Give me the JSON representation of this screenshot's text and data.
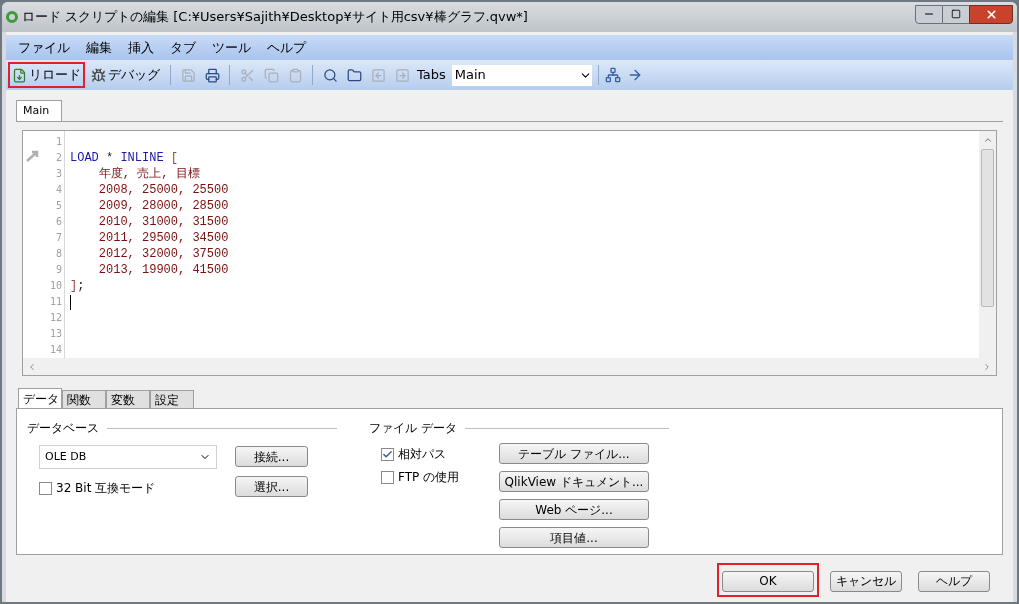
{
  "window": {
    "title": "ロード スクリプトの編集 [C:¥Users¥Sajith¥Desktop¥サイト用csv¥棒グラフ.qvw*]"
  },
  "menu": [
    "ファイル",
    "編集",
    "挿入",
    "タブ",
    "ツール",
    "ヘルプ"
  ],
  "toolbar": {
    "reload": {
      "label": "リロード",
      "highlighted": true
    },
    "debug": {
      "label": "デバッグ",
      "highlighted": false
    },
    "icon_buttons": [
      {
        "disabled": true
      },
      {
        "disabled": false
      },
      {
        "disabled": true
      },
      {
        "disabled": true
      },
      {
        "disabled": true
      },
      {
        "disabled": false
      },
      {
        "disabled": false
      },
      {
        "disabled": true
      },
      {
        "disabled": true
      }
    ],
    "tabs_label": "Tabs",
    "tab_select": "Main"
  },
  "script_tabs": [
    {
      "label": "Main",
      "selected": true
    }
  ],
  "editor": {
    "lines": [
      {
        "number": "1",
        "cursor": false
      },
      {
        "number": "2",
        "cursor": false,
        "tokens": [
          {
            "kind": "keyword",
            "text": "LOAD"
          },
          {
            "kind": "plain",
            "text": " * "
          },
          {
            "kind": "keyword",
            "text": "INLINE"
          },
          {
            "kind": "bracket",
            "text": " ["
          }
        ]
      },
      {
        "number": "3",
        "cursor": false,
        "tokens": [
          {
            "kind": "data",
            "text": "    年度, 売上, 目標"
          }
        ]
      },
      {
        "number": "4",
        "cursor": false,
        "tokens": [
          {
            "kind": "data",
            "text": "    2008, 25000, 25500"
          }
        ]
      },
      {
        "number": "5",
        "cursor": false,
        "tokens": [
          {
            "kind": "data",
            "text": "    2009, 28000, 28500"
          }
        ]
      },
      {
        "number": "6",
        "cursor": false,
        "tokens": [
          {
            "kind": "data",
            "text": "    2010, 31000, 31500"
          }
        ]
      },
      {
        "number": "7",
        "cursor": false,
        "tokens": [
          {
            "kind": "data",
            "text": "    2011, 29500, 34500"
          }
        ]
      },
      {
        "number": "8",
        "cursor": false,
        "tokens": [
          {
            "kind": "data",
            "text": "    2012, 32000, 37500"
          }
        ]
      },
      {
        "number": "9",
        "cursor": false,
        "tokens": [
          {
            "kind": "data",
            "text": "    2013, 19900, 41500"
          }
        ]
      },
      {
        "number": "10",
        "cursor": false,
        "tokens": [
          {
            "kind": "bracket",
            "text": "]"
          },
          {
            "kind": "plain",
            "text": ";"
          }
        ]
      },
      {
        "number": "11",
        "cursor": true
      },
      {
        "number": "12",
        "cursor": false
      },
      {
        "number": "13",
        "cursor": false
      },
      {
        "number": "14",
        "cursor": false
      }
    ]
  },
  "panel_tabs": [
    {
      "label": "データ",
      "selected": true
    },
    {
      "label": "関数",
      "selected": false
    },
    {
      "label": "変数",
      "selected": false
    },
    {
      "label": "設定",
      "selected": false
    }
  ],
  "database": {
    "heading": "データベース",
    "select": "OLE DB",
    "checkbox": {
      "label": "32 Bit 互換モード",
      "checked": false
    },
    "buttons": [
      "接続...",
      "選択..."
    ]
  },
  "file_data": {
    "heading": "ファイル データ",
    "checkboxes": [
      {
        "label": "相対パス",
        "checked": true
      },
      {
        "label": "FTP の使用",
        "checked": false
      }
    ],
    "buttons": [
      "テーブル ファイル...",
      "QlikView ドキュメント...",
      "Web ページ...",
      "項目値..."
    ]
  },
  "footer_buttons": [
    {
      "label": "OK",
      "highlighted": true
    },
    {
      "label": "キャンセル",
      "highlighted": false
    },
    {
      "label": "ヘルプ",
      "highlighted": false
    }
  ]
}
